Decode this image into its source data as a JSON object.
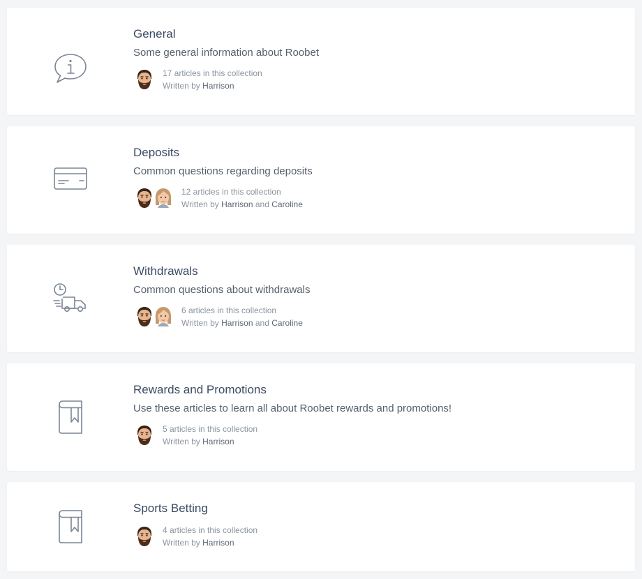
{
  "collections": [
    {
      "icon": "info-bubble-icon",
      "title": "General",
      "description": "Some general information about Roobet",
      "count_text": "17 articles in this collection",
      "written_by": "Written by",
      "authors": [
        "Harrison"
      ],
      "joiner": ""
    },
    {
      "icon": "credit-card-icon",
      "title": "Deposits",
      "description": "Common questions regarding deposits",
      "count_text": "12 articles in this collection",
      "written_by": "Written by",
      "authors": [
        "Harrison",
        "Caroline"
      ],
      "joiner": "and"
    },
    {
      "icon": "delivery-truck-clock-icon",
      "title": "Withdrawals",
      "description": "Common questions about withdrawals",
      "count_text": "6 articles in this collection",
      "written_by": "Written by",
      "authors": [
        "Harrison",
        "Caroline"
      ],
      "joiner": "and"
    },
    {
      "icon": "bookmark-book-icon",
      "title": "Rewards and Promotions",
      "description": "Use these articles to learn all about Roobet rewards and promotions!",
      "count_text": "5 articles in this collection",
      "written_by": "Written by",
      "authors": [
        "Harrison"
      ],
      "joiner": ""
    },
    {
      "icon": "bookmark-book-icon",
      "title": "Sports Betting",
      "description": "",
      "count_text": "4 articles in this collection",
      "written_by": "Written by",
      "authors": [
        "Harrison"
      ],
      "joiner": ""
    }
  ],
  "colors": {
    "background": "#f3f5f7",
    "card": "#ffffff",
    "icon_stroke": "#7a8594",
    "title": "#3b4a63",
    "meta": "#8a939f"
  }
}
